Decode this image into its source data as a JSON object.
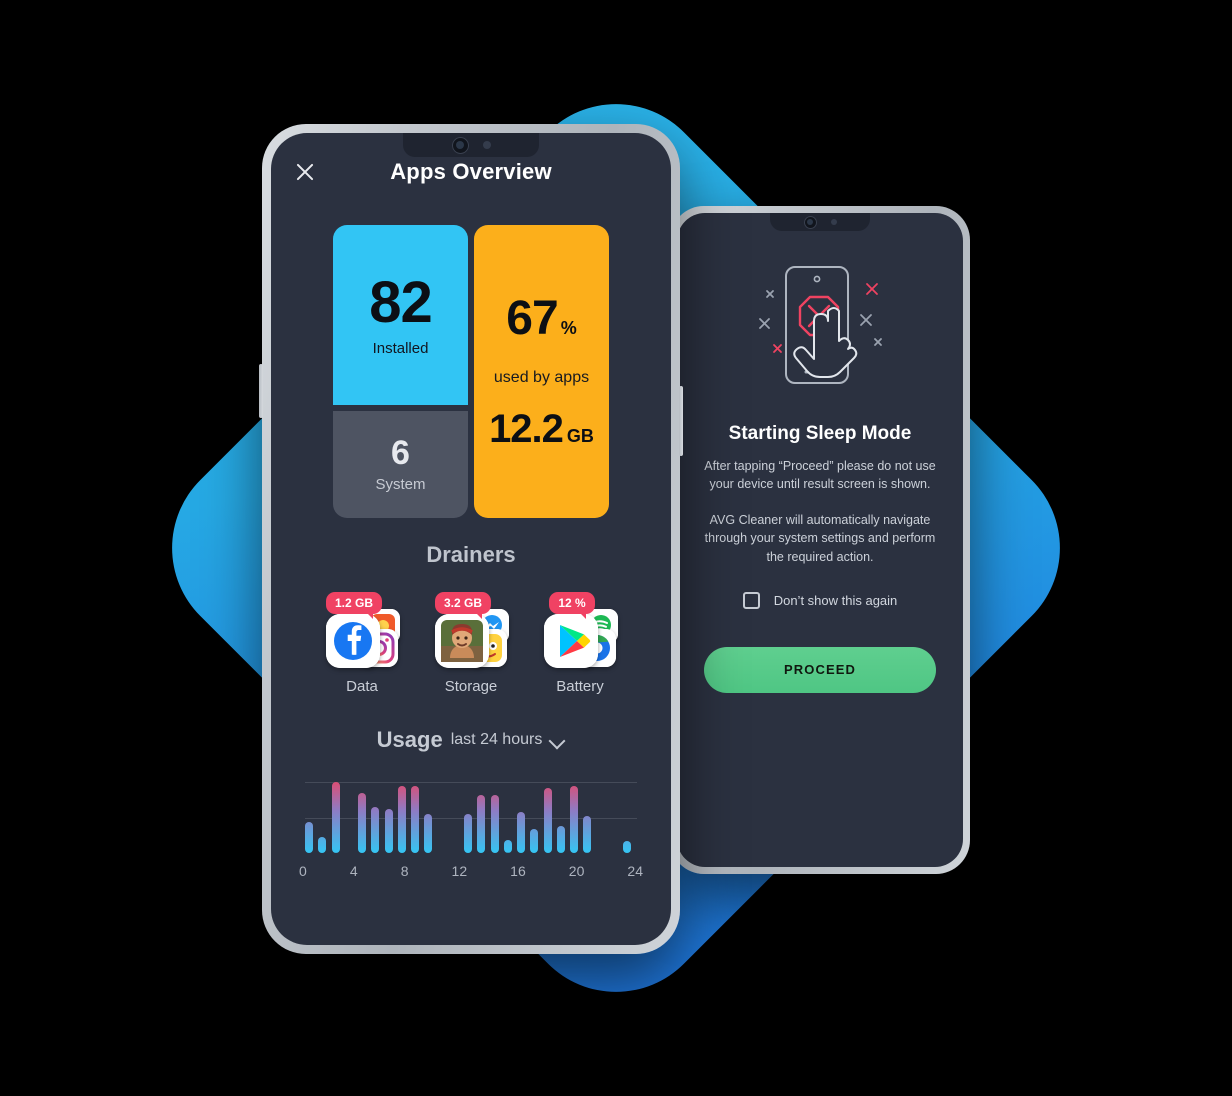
{
  "background": {
    "accent_light": "#2bb3e8",
    "accent_dark": "#1f72d8"
  },
  "front_phone": {
    "header": {
      "title": "Apps Overview",
      "close_icon": "close-icon"
    },
    "cards": {
      "installed": {
        "value": "82",
        "label": "Installed",
        "color": "#32c5f4"
      },
      "system": {
        "value": "6",
        "label": "System",
        "color": "#4e5462"
      },
      "usage": {
        "percent": "67",
        "percent_unit": "%",
        "caption": "used by apps",
        "size": "12.2",
        "size_unit": "GB",
        "color": "#fcaf1b"
      }
    },
    "drainers": {
      "title": "Drainers",
      "items": [
        {
          "badge": "1.2 GB",
          "label": "Data",
          "front_icon": "facebook-icon",
          "back_icons": [
            "instagram-icon",
            "photo-app-icon"
          ]
        },
        {
          "badge": "3.2 GB",
          "label": "Storage",
          "front_icon": "game-app-icon",
          "back_icons": [
            "messenger-icon",
            "cartoon-app-icon"
          ]
        },
        {
          "badge": "12 %",
          "label": "Battery",
          "front_icon": "google-play-icon",
          "back_icons": [
            "spotify-icon",
            "browser-icon"
          ]
        }
      ],
      "badge_color": "#f04263"
    },
    "usage_section": {
      "title": "Usage",
      "range_label": "last 24 hours",
      "chevron_icon": "chevron-down-icon"
    }
  },
  "chart_data": {
    "type": "bar",
    "title": "Usage",
    "subtitle": "last 24 hours",
    "xlabel": "",
    "ylabel": "",
    "grid": true,
    "gridlines": [
      50,
      100
    ],
    "xlim": [
      0,
      24
    ],
    "ylim": [
      0,
      110
    ],
    "tick_labels": [
      "0",
      "4",
      "8",
      "12",
      "16",
      "20",
      "24"
    ],
    "tick_values": [
      0,
      4,
      8,
      12,
      16,
      20,
      24
    ],
    "x": [
      0,
      1,
      2,
      3,
      4,
      5,
      6,
      7,
      8,
      9,
      12,
      13,
      14,
      15,
      16,
      17,
      18,
      19,
      20,
      21,
      24
    ],
    "values": [
      44,
      23,
      100,
      0,
      85,
      65,
      62,
      95,
      95,
      55,
      55,
      82,
      82,
      18,
      58,
      34,
      92,
      38,
      95,
      52,
      17
    ],
    "bar_gradient": [
      "#34c6f4",
      "#ef4361"
    ],
    "gap_hours": [
      10,
      11,
      22,
      23
    ]
  },
  "back_phone": {
    "illustration_icon": "phone-blocked-hand-icon",
    "title": "Starting Sleep Mode",
    "paragraph1": "After tapping “Proceed” please do not use your device until result screen is shown.",
    "paragraph2": "AVG Cleaner will automatically navigate through your system settings and perform the required action.",
    "checkbox": {
      "label": "Don’t show this again",
      "checked": false
    },
    "proceed_button": {
      "label": "PROCEED",
      "color": "#4fc684"
    }
  }
}
